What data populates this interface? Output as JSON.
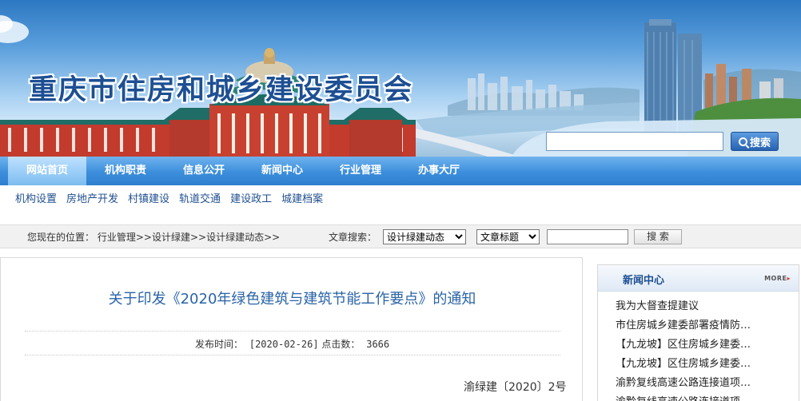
{
  "site": {
    "title": "重庆市住房和城乡建设委员会"
  },
  "search": {
    "placeholder": "",
    "button_label": "搜索"
  },
  "main_nav": [
    {
      "label": "网站首页",
      "active": true
    },
    {
      "label": "机构职责",
      "active": false
    },
    {
      "label": "信息公开",
      "active": false
    },
    {
      "label": "新闻中心",
      "active": false
    },
    {
      "label": "行业管理",
      "active": false
    },
    {
      "label": "办事大厅",
      "active": false
    }
  ],
  "sub_nav": [
    "机构设置",
    "房地产开发",
    "村镇建设",
    "轨道交通",
    "建设政工",
    "城建档案"
  ],
  "breadcrumb": {
    "location_label": "您现在的位置：",
    "items": [
      "行业管理",
      "设计绿建",
      "设计绿建动态"
    ],
    "separator": ">>"
  },
  "article_search": {
    "label": "文章搜索：",
    "category_selected": "设计绿建动态",
    "field_selected": "文章标题",
    "keyword_value": "",
    "button_label": "搜 索"
  },
  "article": {
    "title": "关于印发《2020年绿色建筑与建筑节能工作要点》的通知",
    "publish_label": "发布时间：",
    "publish_date": "[2020-02-26]",
    "clicks_label": "点击数：",
    "clicks_value": "3666",
    "doc_number": "渝绿建〔2020〕2号"
  },
  "news_panel": {
    "title": "新闻中心",
    "more_label": "MORE",
    "items": [
      "我为大督查提建议",
      "市住房城乡建委部署疫情防…",
      "【九龙坡】区住房城乡建委…",
      "【九龙坡】区住房城乡建委…",
      "渝黔复线高速公路连接道项…",
      "渝黔复线高速公路连接道项…"
    ]
  },
  "colors": {
    "nav_blue": "#3c8edb",
    "title_blue": "#2a64a7",
    "site_title_blue": "#1d4f93",
    "more_arrow_red": "#d23a2a"
  },
  "icons": {
    "search_button": "search-icon",
    "more_arrow": "triangle-right-icon"
  }
}
